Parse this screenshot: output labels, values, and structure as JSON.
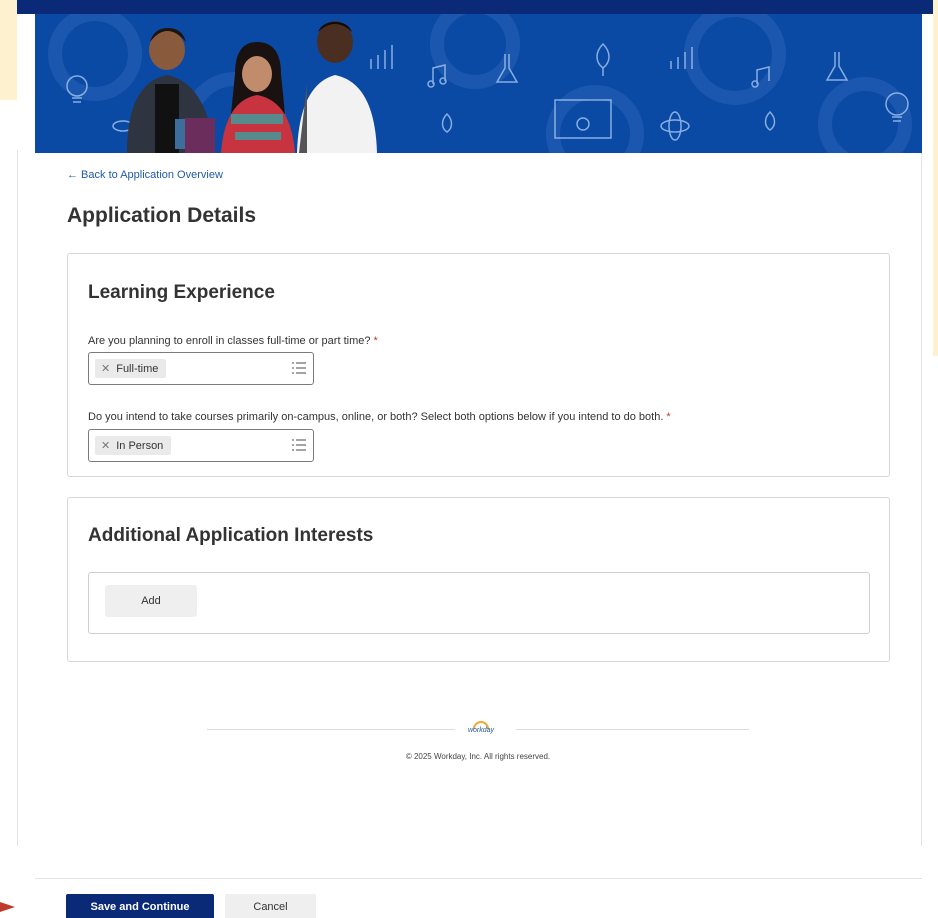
{
  "colors": {
    "brand_navy": "#0a2a78",
    "banner_blue": "#0b4aa4",
    "link_blue": "#1f5aa6",
    "required_red": "#c0392b",
    "accent_cream": "#fdf1d0"
  },
  "nav": {
    "back_link": "← Back to Application Overview"
  },
  "page": {
    "title": "Application Details"
  },
  "learning": {
    "title": "Learning Experience",
    "q1": {
      "label": "Are you planning to enroll in classes full-time or part time?",
      "required_mark": "*",
      "value": "Full-time"
    },
    "q2": {
      "label": "Do you intend to take courses primarily on-campus, online, or both? Select both options below if you intend to do both.",
      "required_mark": "*",
      "value": "In Person"
    }
  },
  "additional": {
    "title": "Additional Application Interests",
    "add_label": "Add"
  },
  "footer": {
    "logo_text": "workday",
    "copyright": "© 2025 Workday, Inc. All rights reserved."
  },
  "actions": {
    "save_label": "Save and Continue",
    "cancel_label": "Cancel"
  },
  "icons": {
    "remove": "close-icon",
    "list": "list-icon",
    "arrow": "arrow-right-icon"
  }
}
